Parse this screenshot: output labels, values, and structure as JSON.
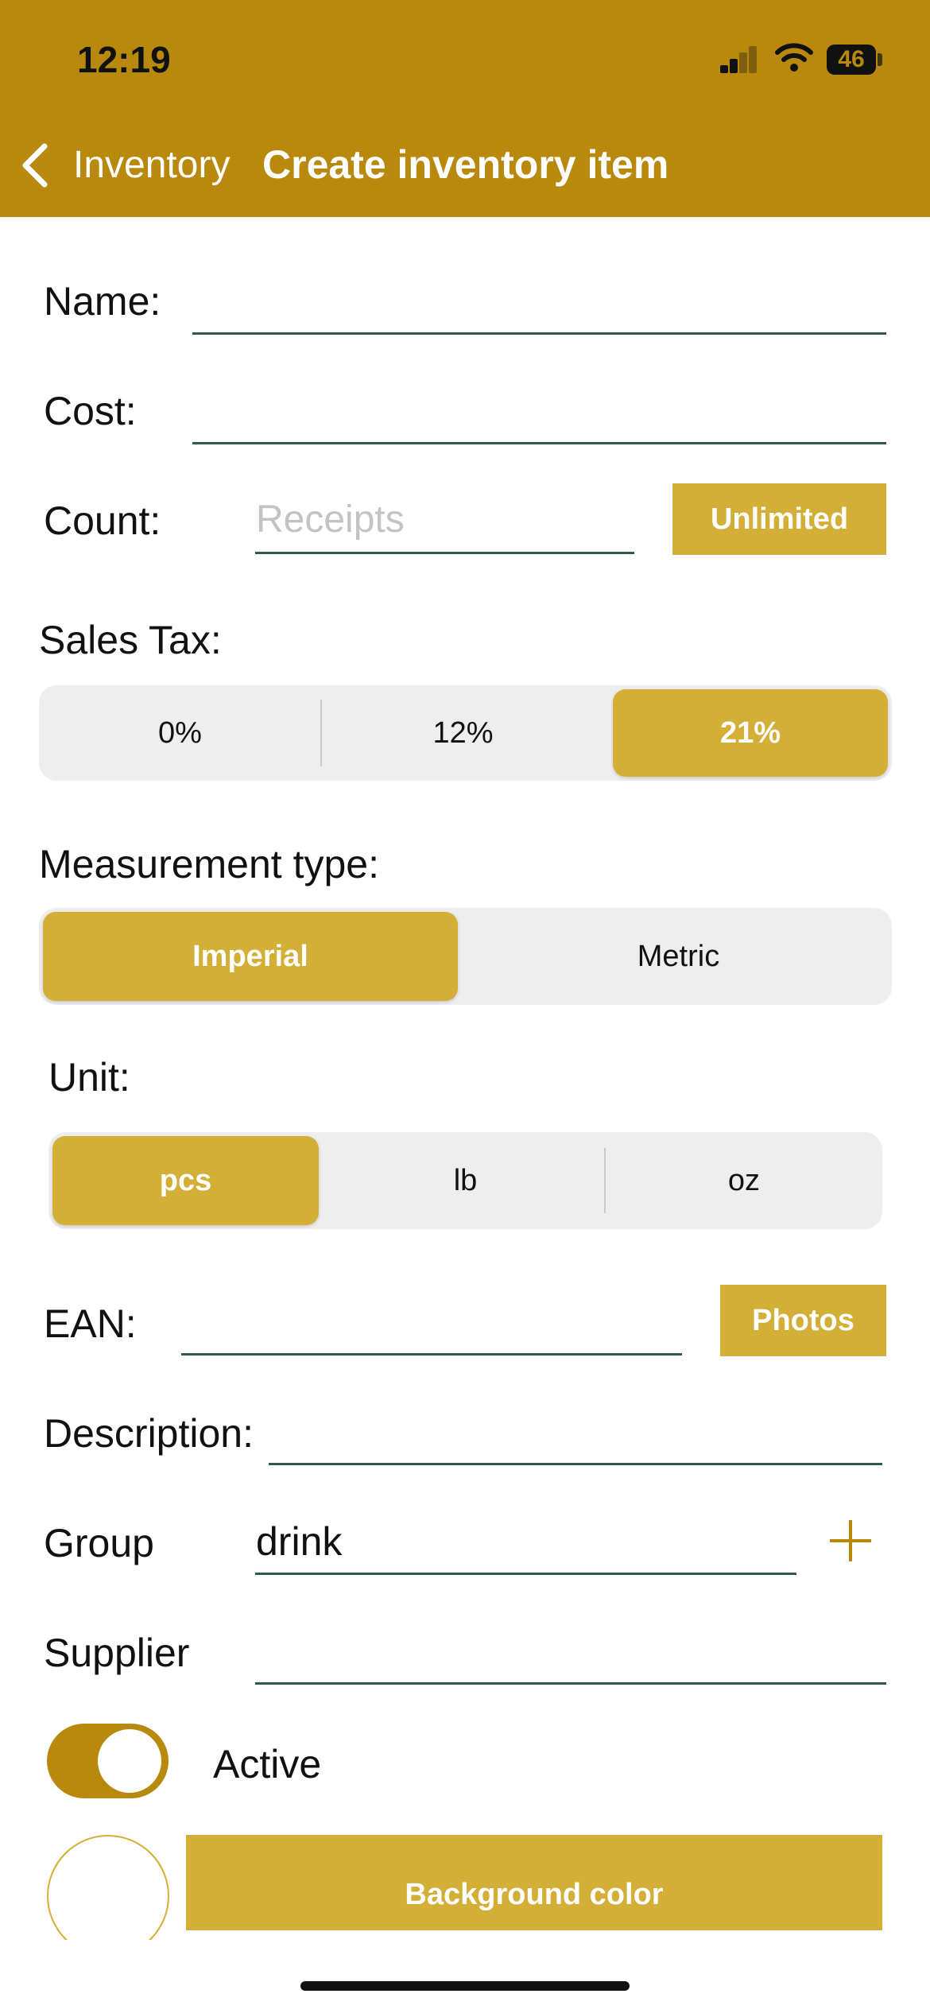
{
  "status_bar": {
    "time": "12:19",
    "battery": "46"
  },
  "nav": {
    "back_label": "Inventory",
    "title": "Create inventory item"
  },
  "form": {
    "name_label": "Name:",
    "cost_label": "Cost:",
    "count_label": "Count:",
    "count_placeholder": "Receipts",
    "unlimited_button": "Unlimited",
    "sales_tax_label": "Sales Tax:",
    "sales_tax_options": [
      "0%",
      "12%",
      "21%"
    ],
    "sales_tax_selected": "21%",
    "measurement_label": "Measurement type:",
    "measurement_options": [
      "Imperial",
      "Metric"
    ],
    "measurement_selected": "Imperial",
    "unit_label": "Unit:",
    "unit_options": [
      "pcs",
      "lb",
      "oz"
    ],
    "unit_selected": "pcs",
    "ean_label": "EAN:",
    "photos_button": "Photos",
    "description_label": "Description:",
    "group_label": "Group",
    "group_value": "drink",
    "supplier_label": "Supplier",
    "active_label": "Active",
    "active_on": true,
    "background_color_button": "Background color"
  },
  "colors": {
    "accent": "#B8890D",
    "button": "#D4AF37",
    "segment_bg": "#EEEEEE",
    "underline": "#2F5A48"
  },
  "icons": {
    "back": "chevron-left-icon",
    "add": "plus-icon",
    "wifi": "wifi-icon",
    "signal": "signal-icon",
    "battery": "battery-icon"
  }
}
